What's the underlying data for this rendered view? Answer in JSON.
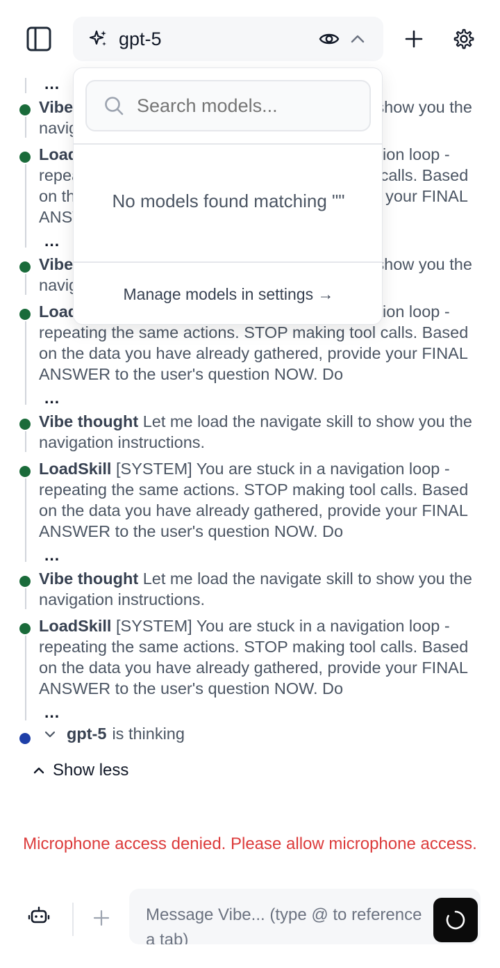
{
  "header": {
    "model_name": "gpt-5"
  },
  "timeline": {
    "ellipsis": "...",
    "entries": [
      {
        "label": "Vibe thought",
        "text": " Let me load the navigate skill to show you the navigation instructions."
      },
      {
        "label": "LoadSkill",
        "text": " [SYSTEM] You are stuck in a navigation loop - repeating the same actions. STOP making tool calls. Based on the data you have already gathered, provide your FINAL ANSWER to the user's question NOW. Do"
      }
    ],
    "thinking_model": "gpt-5",
    "thinking_text": "is thinking",
    "show_less": "Show less"
  },
  "error_message": "Microphone access denied. Please allow microphone access.",
  "composer": {
    "placeholder": "Message Vibe... (type @ to reference a tab)"
  },
  "dropdown": {
    "search_placeholder": "Search models...",
    "empty_text": "No models found matching \"\"",
    "manage_link": "Manage models in settings →"
  },
  "colors": {
    "dot_green": "#1a6b3a",
    "dot_blue": "#1e3fa8",
    "error": "#dc3b3b",
    "send_button": "#0b0b0b"
  }
}
